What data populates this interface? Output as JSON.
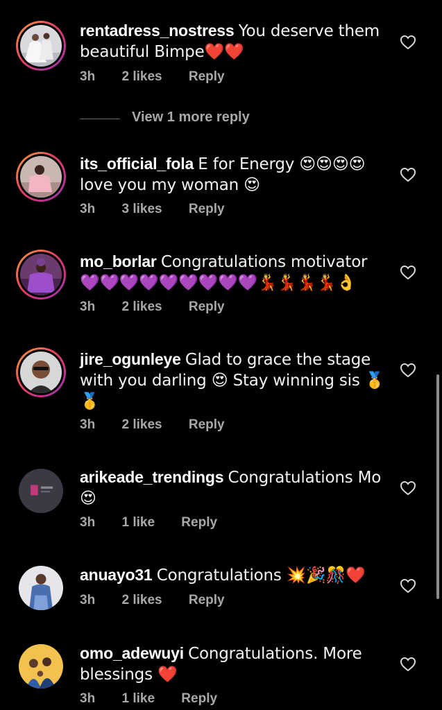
{
  "comments": [
    {
      "username": "rentadress_nostress",
      "text": "You deserve them beautiful Bimpe❤️❤️",
      "time": "3h",
      "likes": "2 likes",
      "reply": "Reply",
      "avatar": "wedding-dress-photo"
    },
    {
      "username": "its_official_fola",
      "text": "E for Energy 😍😍😍😍 love you my woman 😍",
      "time": "3h",
      "likes": "3 likes",
      "reply": "Reply",
      "avatar": "woman-pink-photo"
    },
    {
      "username": "mo_borlar",
      "text": "Congratulations motivator 💜💜💜💜💜💜💜💜💜💃💃💃💃👌",
      "time": "3h",
      "likes": "2 likes",
      "reply": "Reply",
      "avatar": "woman-purple-photo"
    },
    {
      "username": "jire_ogunleye",
      "text": "Glad to grace the stage with you darling 😍 Stay winning sis 🥇🥇",
      "time": "3h",
      "likes": "2 likes",
      "reply": "Reply",
      "avatar": "man-sunglasses-photo"
    },
    {
      "username": "arikeade_trendings",
      "text": "Congratulations Mo 😍",
      "time": "3h",
      "likes": "1 like",
      "reply": "Reply",
      "avatar": "dark-logo-photo"
    },
    {
      "username": "anuayo31",
      "text": "Congratulations 💥🎉🎊❤️",
      "time": "3h",
      "likes": "2 likes",
      "reply": "Reply",
      "avatar": "woman-blue-dress-photo"
    },
    {
      "username": "omo_adewuyi",
      "text": "Congratulations. More blessings ❤️",
      "time": "3h",
      "likes": "1 like",
      "reply": "Reply",
      "avatar": "family-photo"
    }
  ],
  "view_more_replies": "View 1 more reply",
  "icons": {
    "like": "heart-outline-icon"
  },
  "colors": {
    "background": "#000000",
    "meta_text": "#a8a8a8",
    "story_ring_start": "#f9a13a",
    "story_ring_end": "#8a3ab9"
  }
}
